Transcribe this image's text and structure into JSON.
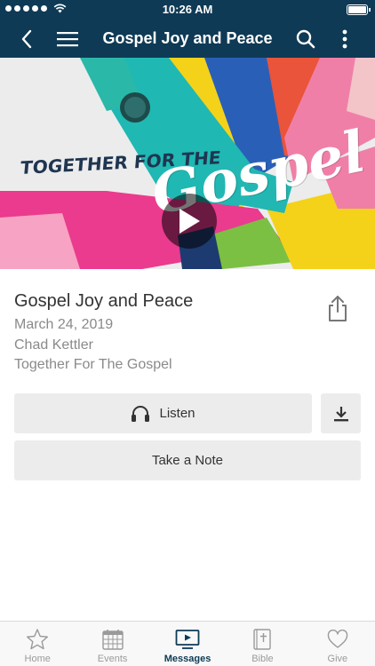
{
  "status_bar": {
    "time": "10:26 AM",
    "signal_dots": 5
  },
  "nav": {
    "title": "Gospel Joy and Peace",
    "back_icon": "chevron-left-icon",
    "menu_icon": "hamburger-icon",
    "search_icon": "search-icon",
    "more_icon": "vertical-dots-icon"
  },
  "hero": {
    "caption_left": "TOGETHER FOR THE",
    "caption_script": "Gospel",
    "play_icon": "play-icon"
  },
  "message": {
    "title": "Gospel Joy and Peace",
    "date": "March 24, 2019",
    "speaker": "Chad Kettler",
    "series": "Together For The Gospel"
  },
  "actions": {
    "listen_label": "Listen",
    "note_label": "Take a Note",
    "download_icon": "download-icon",
    "share_icon": "share-icon",
    "headphones_icon": "headphones-icon"
  },
  "tabs": [
    {
      "label": "Home",
      "icon": "star-icon",
      "active": false
    },
    {
      "label": "Events",
      "icon": "calendar-icon",
      "active": false
    },
    {
      "label": "Messages",
      "icon": "tv-icon",
      "active": true
    },
    {
      "label": "Bible",
      "icon": "bible-icon",
      "active": false
    },
    {
      "label": "Give",
      "icon": "heart-icon",
      "active": false
    }
  ],
  "colors": {
    "header": "#0e3a55",
    "active_tab": "#0e3a55",
    "button_bg": "#ececec",
    "secondary_text": "#8a8a8a"
  }
}
